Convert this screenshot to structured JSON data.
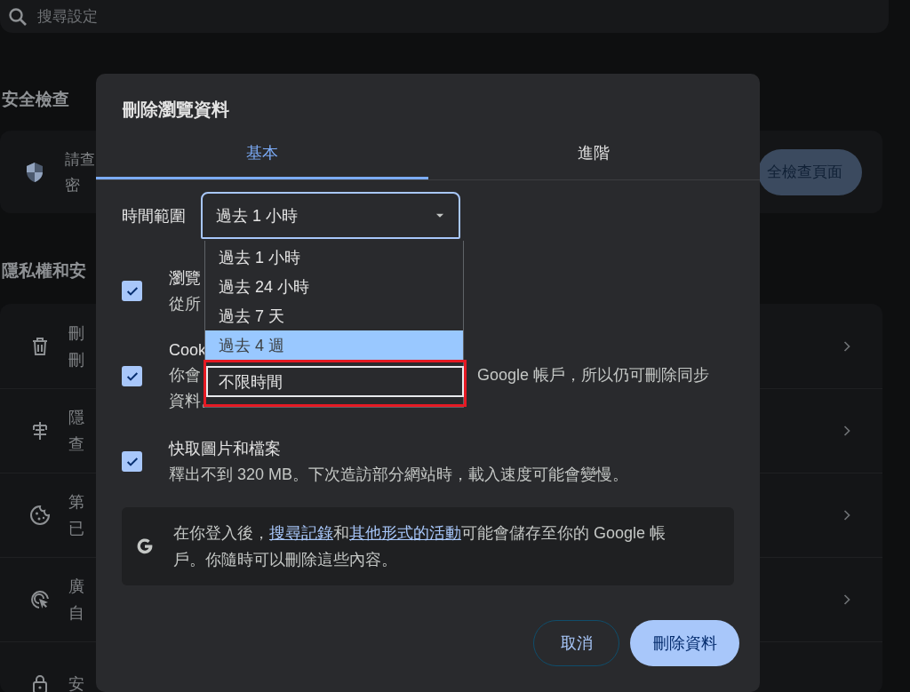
{
  "search": {
    "placeholder": "搜尋設定"
  },
  "safety_check": {
    "heading": "安全檢查",
    "lines": [
      "請查",
      "密"
    ],
    "button": "全檢查頁面"
  },
  "privacy": {
    "heading": "隱私權和安",
    "rows": [
      {
        "kind": "trash",
        "lines": [
          "刪",
          "刪"
        ],
        "chevron": true
      },
      {
        "kind": "guide",
        "lines": [
          "隱",
          "查"
        ],
        "chevron": true
      },
      {
        "kind": "cookie",
        "lines": [
          "第",
          "已"
        ],
        "chevron": true
      },
      {
        "kind": "ads",
        "lines": [
          "廣",
          "自"
        ],
        "chevron": true
      },
      {
        "kind": "lock",
        "lines": [
          "安"
        ],
        "chevron": false
      }
    ]
  },
  "dialog": {
    "title": "刪除瀏覽資料",
    "tabs": [
      {
        "label": "基本",
        "selected": true
      },
      {
        "label": "進階",
        "selected": false
      }
    ],
    "time_range": {
      "label": "時間範圍",
      "value": "過去 1 小時",
      "expanded": true,
      "options": [
        {
          "label": "過去 1 小時",
          "highlighted": false,
          "focused": false
        },
        {
          "label": "過去 24 小時",
          "highlighted": false,
          "focused": false
        },
        {
          "label": "過去 7 天",
          "highlighted": false,
          "focused": false
        },
        {
          "label": "過去 4 週",
          "highlighted": true,
          "focused": false
        },
        {
          "label": "不限時間",
          "highlighted": false,
          "focused": true
        }
      ]
    },
    "items": [
      {
        "checked": true,
        "title": "瀏覽",
        "description_lines": [
          [
            "從所"
          ]
        ]
      },
      {
        "checked": true,
        "title": "Cook",
        "description_lines": [
          [
            "你會",
            "Google 帳戶，所以仍可刪除同步"
          ],
          [
            "資料。"
          ]
        ]
      },
      {
        "checked": true,
        "title": "快取圖片和檔案",
        "description_lines": [
          [
            "釋出不到 320 MB。下次造訪部分網站時，載入速度可能會變慢。"
          ]
        ]
      }
    ],
    "info": {
      "parts": [
        {
          "kind": "text",
          "text": "在你登入後，"
        },
        {
          "kind": "link",
          "text": "搜尋記錄"
        },
        {
          "kind": "text",
          "text": "和"
        },
        {
          "kind": "link",
          "text": "其他形式的活動"
        },
        {
          "kind": "text",
          "text": "可能會儲存至你的 Google 帳戶。你隨時可以刪除這些內容。"
        }
      ]
    },
    "buttons": [
      {
        "kind": "outline",
        "label": "取消"
      },
      {
        "kind": "filled",
        "label": "刪除資料"
      }
    ]
  }
}
